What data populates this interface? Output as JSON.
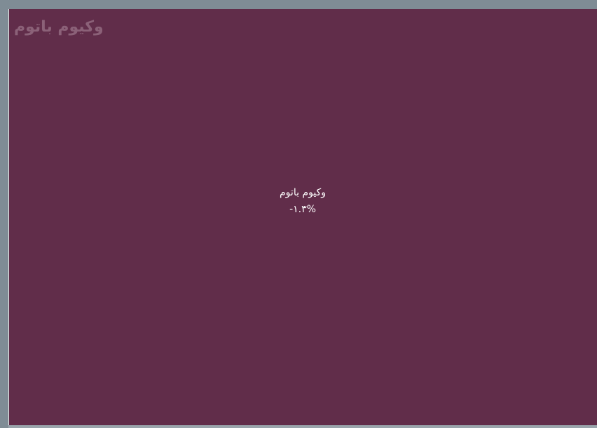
{
  "watermark": {
    "text": "وکیوم باتوم"
  },
  "tile": {
    "name": "وکیوم باتوم",
    "change": "-۱.۳%",
    "color": "#612d4a"
  }
}
